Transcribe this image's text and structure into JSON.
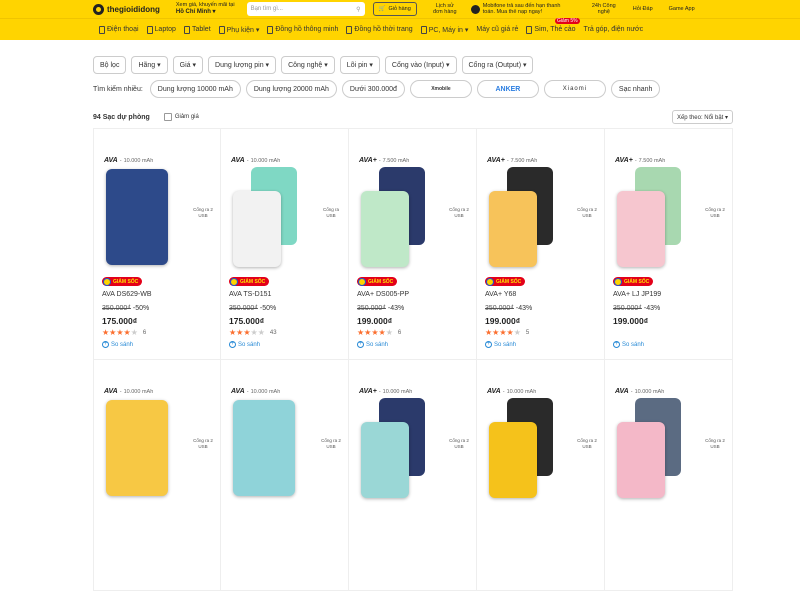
{
  "header": {
    "logo": "thegioididong",
    "location_label": "Xem giá, khuyến mãi tại",
    "location_value": "Hồ Chí Minh ▾",
    "search_placeholder": "Bạn tìm gì...",
    "cart_label": "Giỏ hàng",
    "history_label": "Lịch sử đơn hàng",
    "promo_text": "Mobifone trả sau đến hạn thanh toán. Mua thẻ nạp ngay!",
    "tech24_label": "24h Công nghệ",
    "qa_label": "Hỏi Đáp",
    "game_label": "Game App"
  },
  "nav": {
    "items": [
      "Điện thoại",
      "Laptop",
      "Tablet",
      "Phụ kiện ▾",
      "Đồng hồ thông minh",
      "Đồng hồ thời trang",
      "PC, Máy in ▾",
      "Máy cũ giá rẻ",
      "Sim, Thẻ cào",
      "Trả góp, điện nước"
    ],
    "sim_badge": "Giảm 5%"
  },
  "filters": [
    "Bộ lọc",
    "Hãng ▾",
    "Giá ▾",
    "Dung lượng pin ▾",
    "Công nghệ ▾",
    "Lõi pin ▾",
    "Cổng vào (Input) ▾",
    "Cổng ra (Output) ▾"
  ],
  "suggest": {
    "label": "Tìm kiếm nhiều:",
    "chips": [
      "Dung lượng 10000 mAh",
      "Dung lượng 20000 mAh",
      "Dưới 300.000đ"
    ],
    "brands": [
      "Xmobile",
      "ANKER",
      "Xiaomi"
    ],
    "extra": "Sạc nhanh"
  },
  "listing": {
    "count": "94 Sạc dự phòng",
    "discount_filter": "Giảm giá",
    "sort": "Xếp theo: Nổi bật ▾"
  },
  "products": [
    {
      "brand": "AVA",
      "cap": "10.000 mAh",
      "ports": "Cổng ra 2 USB",
      "promo": "GIẢM SỐC",
      "name": "AVA DS629-WB",
      "old": "350.000₫",
      "disc": "-50%",
      "price": "175.000₫",
      "stars": 3.5,
      "reviews": "6",
      "compare": "So sánh",
      "color": "#2d4a8a",
      "color2": ""
    },
    {
      "brand": "AVA",
      "cap": "10.000 mAh",
      "ports": "Cổng ra USB",
      "promo": "GIẢM SỐC",
      "name": "AVA TS-D151",
      "old": "350.000₫",
      "disc": "-50%",
      "price": "175.000₫",
      "stars": 3,
      "reviews": "43",
      "compare": "So sánh",
      "color": "#7fd8c4",
      "color2": "#f2f2f2"
    },
    {
      "brand": "AVA+",
      "cap": "7.500 mAh",
      "ports": "Cổng ra 2 USB",
      "promo": "GIẢM SỐC",
      "name": "AVA+ DS005-PP",
      "old": "350.000₫",
      "disc": "-43%",
      "price": "199.000₫",
      "stars": 4,
      "reviews": "6",
      "compare": "So sánh",
      "color": "#2b3a6b",
      "color2": "#bfe8c8"
    },
    {
      "brand": "AVA+",
      "cap": "7.500 mAh",
      "ports": "Cổng ra 2 USB",
      "promo": "GIẢM SỐC",
      "name": "AVA+ Y68",
      "old": "350.000₫",
      "disc": "-43%",
      "price": "199.000₫",
      "stars": 4,
      "reviews": "5",
      "compare": "So sánh",
      "color": "#2a2a2a",
      "color2": "#f7c35a"
    },
    {
      "brand": "AVA+",
      "cap": "7.500 mAh",
      "ports": "Cổng ra 2 USB",
      "promo": "GIẢM SỐC",
      "name": "AVA+ LJ JP199",
      "old": "350.000₫",
      "disc": "-43%",
      "price": "199.000₫",
      "stars": 0,
      "reviews": "",
      "compare": "So sánh",
      "color": "#a8d8b0",
      "color2": "#f6c6cf"
    },
    {
      "brand": "AVA",
      "cap": "10.000 mAh",
      "ports": "Cổng ra 2 USB",
      "promo": "",
      "name": "",
      "old": "",
      "disc": "",
      "price": "",
      "stars": 0,
      "reviews": "",
      "compare": "",
      "color": "#f7c844",
      "color2": ""
    },
    {
      "brand": "AVA",
      "cap": "10.000 mAh",
      "ports": "Cổng ra 2 USB",
      "promo": "",
      "name": "",
      "old": "",
      "disc": "",
      "price": "",
      "stars": 0,
      "reviews": "",
      "compare": "",
      "color": "#8fd3d9",
      "color2": ""
    },
    {
      "brand": "AVA+",
      "cap": "10.000 mAh",
      "ports": "Cổng ra 2 USB",
      "promo": "",
      "name": "",
      "old": "",
      "disc": "",
      "price": "",
      "stars": 0,
      "reviews": "",
      "compare": "",
      "color": "#2b3a6b",
      "color2": "#9ad7d6"
    },
    {
      "brand": "AVA",
      "cap": "10.000 mAh",
      "ports": "Cổng ra 2 USB",
      "promo": "",
      "name": "",
      "old": "",
      "disc": "",
      "price": "",
      "stars": 0,
      "reviews": "",
      "compare": "",
      "color": "#2a2a2a",
      "color2": "#f5c21b"
    },
    {
      "brand": "AVA",
      "cap": "10.000 mAh",
      "ports": "Cổng ra 2 USB",
      "promo": "",
      "name": "",
      "old": "",
      "disc": "",
      "price": "",
      "stars": 0,
      "reviews": "",
      "compare": "",
      "color": "#5b6b82",
      "color2": "#f4b8c8"
    }
  ]
}
